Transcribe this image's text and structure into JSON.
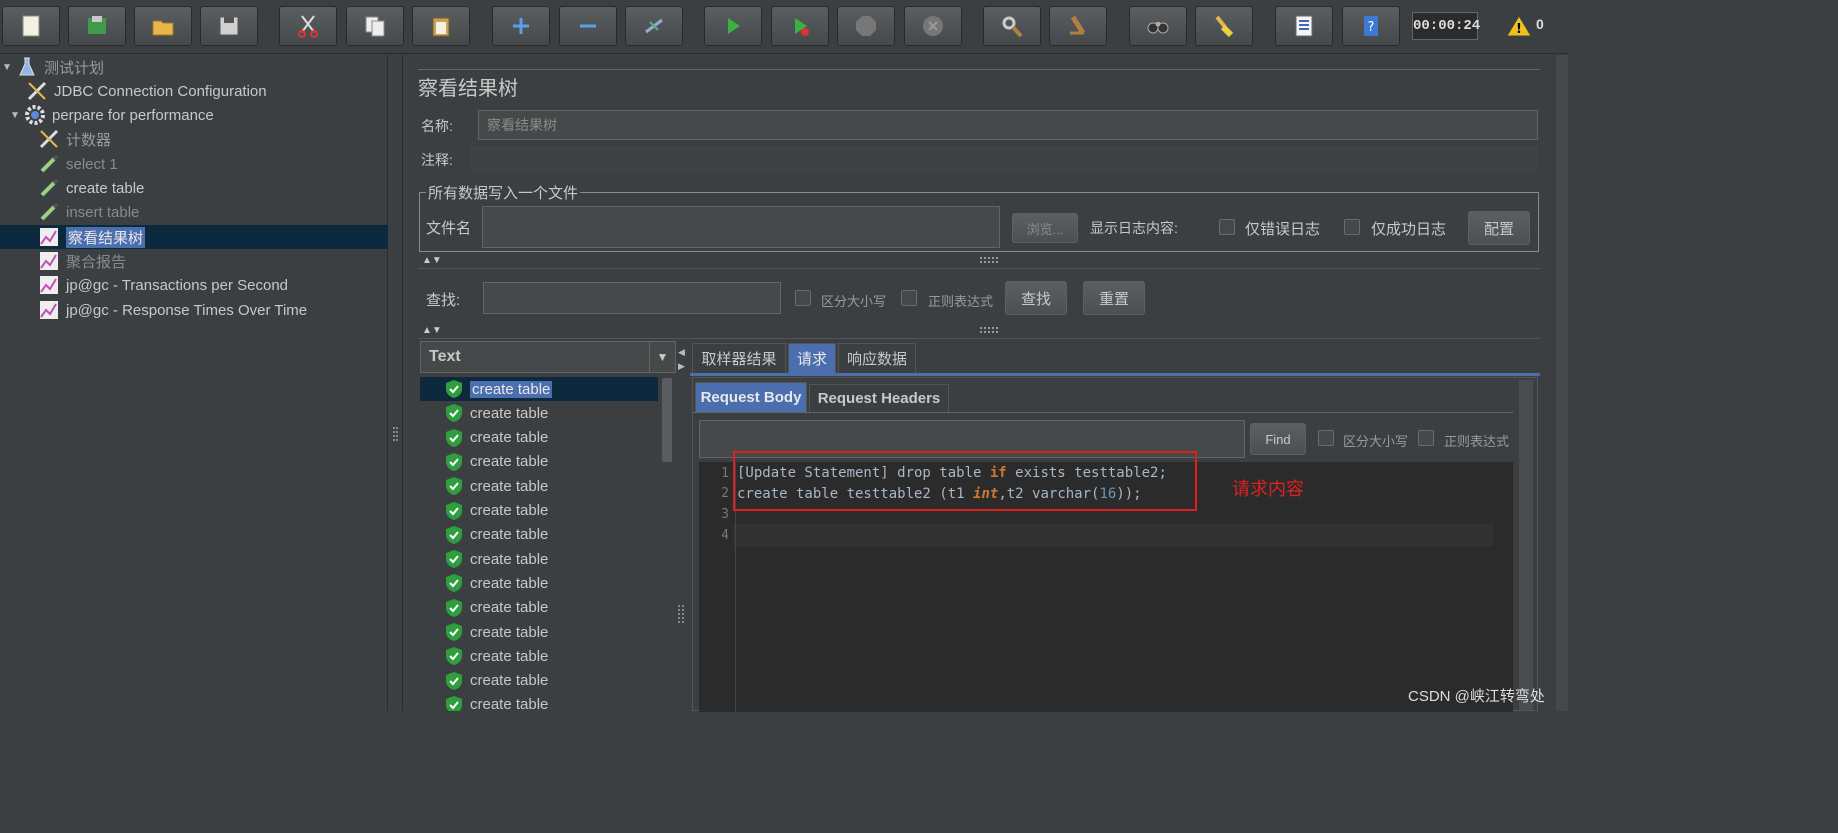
{
  "toolbar": {
    "timer": "00:00:24",
    "warning_count": "0",
    "buttons": [
      "new-icon",
      "templates-icon",
      "open-icon",
      "save-icon",
      "cut-icon",
      "copy-icon",
      "paste-icon",
      "expand-icon",
      "collapse-icon",
      "toggle-icon",
      "start-icon",
      "start-no-pause-icon",
      "stop-icon",
      "shutdown-icon",
      "clear-icon",
      "clear-all-icon",
      "search-icon",
      "reset-search-icon",
      "function-helper-icon",
      "help-icon"
    ]
  },
  "tree": {
    "items": [
      {
        "label": "测试计划",
        "icon": "flask-icon"
      },
      {
        "label": "JDBC Connection Configuration",
        "icon": "wrench-icon"
      },
      {
        "label": "perpare for performance",
        "icon": "gear-icon"
      },
      {
        "label": "计数器",
        "icon": "wrench-icon"
      },
      {
        "label": "select 1",
        "icon": "pipette-icon"
      },
      {
        "label": "create table",
        "icon": "pipette-icon"
      },
      {
        "label": "insert table",
        "icon": "pipette-icon"
      },
      {
        "label": "察看结果树",
        "icon": "chart-icon"
      },
      {
        "label": "聚合报告",
        "icon": "chart-icon"
      },
      {
        "label": "jp@gc - Transactions per Second",
        "icon": "chart-icon"
      },
      {
        "label": "jp@gc - Response Times Over Time",
        "icon": "chart-icon"
      }
    ]
  },
  "listener": {
    "title": "察看结果树",
    "name_label": "名称:",
    "name_value": "察看结果树",
    "comment_label": "注释:",
    "comment_value": "",
    "file_group_title": "所有数据写入一个文件",
    "filename_label": "文件名",
    "filename_value": "",
    "browse_label": "浏览...",
    "log_content_label": "显示日志内容:",
    "errors_only_label": "仅错误日志",
    "success_only_label": "仅成功日志",
    "configure_label": "配置",
    "search_label": "查找:",
    "search_value": "",
    "case_sensitive_label": "区分大小写",
    "regex_label": "正则表达式",
    "find_label": "查找",
    "reset_label": "重置",
    "renderer_value": "Text"
  },
  "results": {
    "items": [
      "create table",
      "create table",
      "create table",
      "create table",
      "create table",
      "create table",
      "create table",
      "create table",
      "create table",
      "create table",
      "create table",
      "create table",
      "create table",
      "create table"
    ]
  },
  "detail": {
    "tabs": [
      "取样器结果",
      "请求",
      "响应数据"
    ],
    "active_tab": "请求",
    "subtabs": [
      "Request Body",
      "Request Headers"
    ],
    "active_subtab": "Request Body",
    "find_label": "Find",
    "find_value": "",
    "case_sensitive_label": "区分大小写",
    "regex_label": "正则表达式",
    "line_numbers": [
      "1",
      "2",
      "3",
      "4"
    ],
    "code": {
      "line1_a": "[Update Statement] drop table ",
      "line1_kw": "if",
      "line1_b": " exists testtable2;",
      "line2_a": "create table testtable2 (t1 ",
      "line2_kw": "int",
      "line2_b": ",t2 varchar(",
      "line2_num": "16",
      "line2_c": "));"
    },
    "annotation": "请求内容"
  },
  "watermark": "CSDN @峡江转弯处",
  "colors": {
    "annotation": "#e02020",
    "keyword": "#cc7832",
    "number": "#6897bb",
    "selection": "#4b6eaf",
    "start": "#3cb043"
  }
}
